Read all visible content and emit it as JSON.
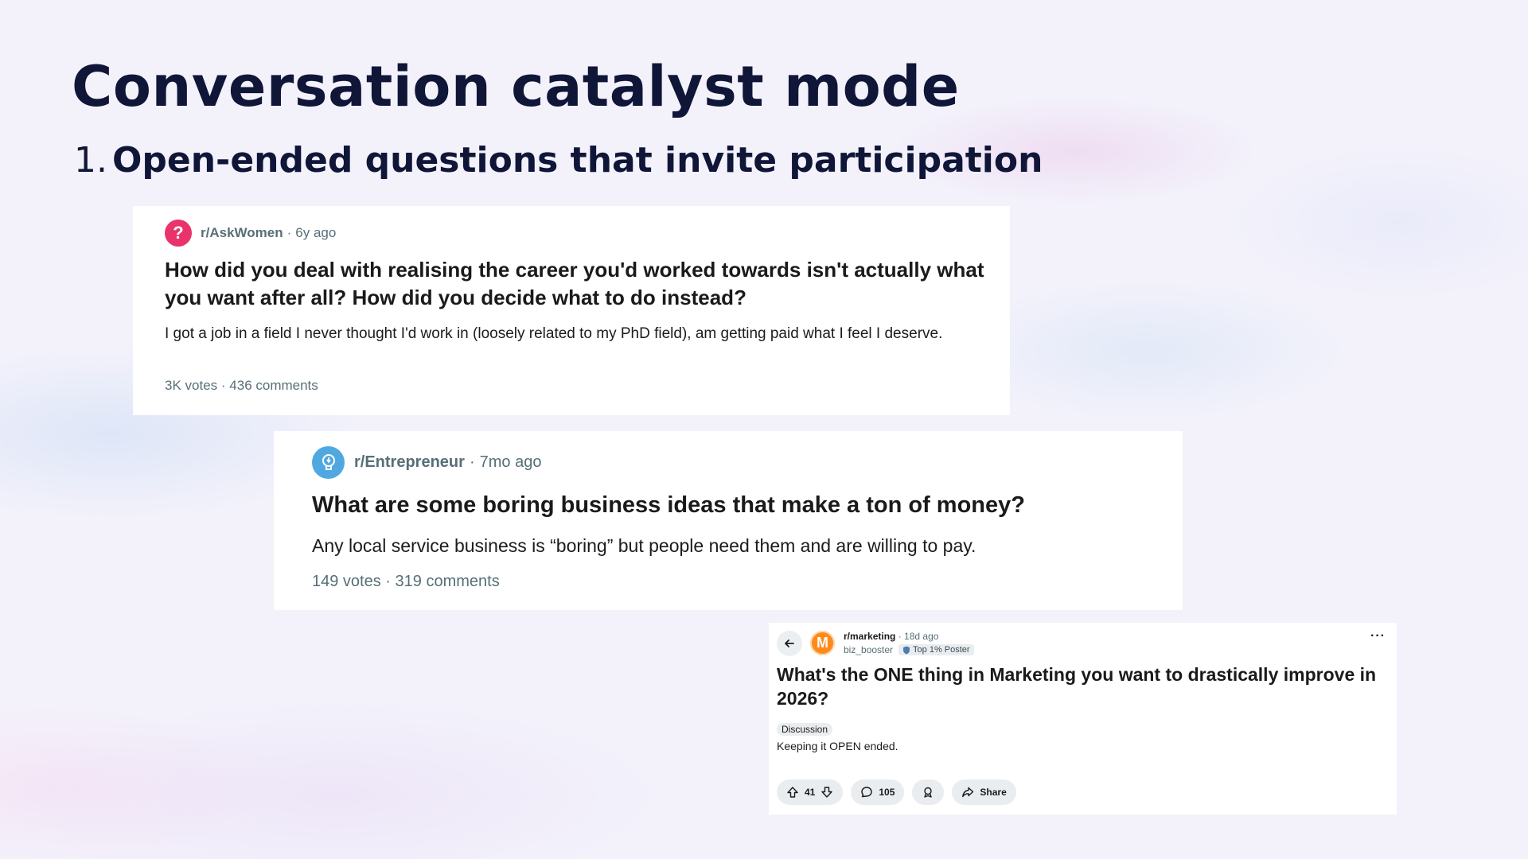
{
  "slide": {
    "title": "Conversation catalyst mode",
    "point_number": "1.",
    "point_text": "Open-ended questions that invite participation"
  },
  "posts": [
    {
      "subreddit": "r/AskWomen",
      "time": "6y ago",
      "avatar_icon": "question-mark-icon",
      "avatar_color": "#e8336b",
      "title": "How did you deal with realising the career you'd worked towards isn't actually what you want after all? How did you decide what to do instead?",
      "body": "I got a job in a field I never thought I'd work in (loosely related to my PhD field), am getting paid what I feel I deserve.",
      "votes": "3K votes",
      "comments": "436 comments"
    },
    {
      "subreddit": "r/Entrepreneur",
      "time": "7mo ago",
      "avatar_icon": "lightbulb-icon",
      "avatar_color": "#4fa9e0",
      "title": "What are some boring business ideas that make a ton of money?",
      "body": "Any local service business is “boring” but people need them and are willing to pay.",
      "votes": "149 votes",
      "comments": "319 comments"
    },
    {
      "subreddit": "r/marketing",
      "time": "18d ago",
      "username": "biz_booster",
      "user_flair": "Top 1% Poster",
      "avatar_icon": "marketing-m-icon",
      "avatar_color": "#ff8a1c",
      "title": "What's the ONE thing in Marketing you want to drastically improve in 2026?",
      "post_flair": "Discussion",
      "body": "Keeping it OPEN ended.",
      "vote_count": "41",
      "comment_count": "105",
      "share_label": "Share",
      "more_label": "···"
    }
  ]
}
